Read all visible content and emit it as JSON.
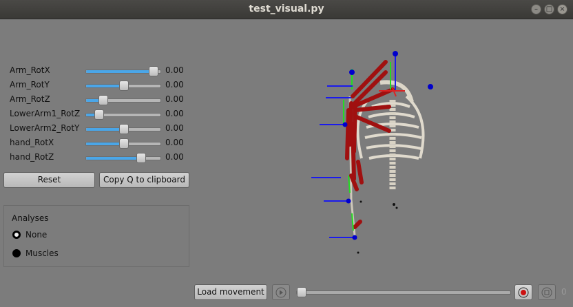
{
  "window": {
    "title": "test_visual.py"
  },
  "sliders": [
    {
      "label": "Arm_RotX",
      "value": "0.00",
      "position": 0.9
    },
    {
      "label": "Arm_RotY",
      "value": "0.00",
      "position": 0.5
    },
    {
      "label": "Arm_RotZ",
      "value": "0.00",
      "position": 0.22
    },
    {
      "label": "LowerArm1_RotZ",
      "value": "0.00",
      "position": 0.17
    },
    {
      "label": "LowerArm2_RotY",
      "value": "0.00",
      "position": 0.5
    },
    {
      "label": "hand_RotX",
      "value": "0.00",
      "position": 0.5
    },
    {
      "label": "hand_RotZ",
      "value": "0.00",
      "position": 0.73
    }
  ],
  "buttons": {
    "reset": "Reset",
    "copy_q": "Copy Q to clipboard",
    "load_movement": "Load movement"
  },
  "analyses": {
    "title": "Analyses",
    "options": [
      "None",
      "Muscles"
    ],
    "selected": "None"
  },
  "player": {
    "frame": "0",
    "progress": 0
  },
  "icons": {
    "play": "play-icon",
    "record": "record-icon",
    "stop": "stop-icon"
  },
  "colors": {
    "accent": "#4aa6e8",
    "muscle": "#a01010",
    "marker": "#0000cc"
  }
}
